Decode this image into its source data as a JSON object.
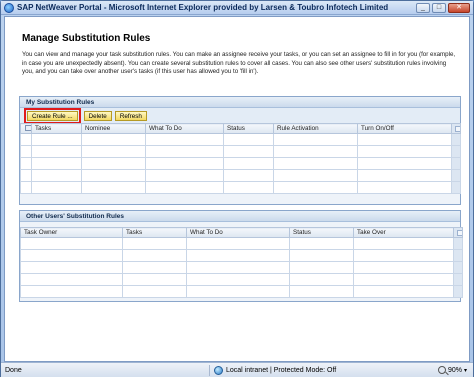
{
  "window": {
    "title": "SAP NetWeaver Portal - Microsoft Internet Explorer provided by Larsen & Toubro Infotech Limited",
    "minimize": "_",
    "maximize": "□",
    "close": "✕"
  },
  "page": {
    "title": "Manage Substitution Rules",
    "description": [
      "You can view and manage your task substitution rules. You can make an assignee receive your tasks, or you can set an assignee to fill in for you (for example,",
      "in case you are unexpectedly absent). You can create several substitution rules to cover all cases. You can also see other users' substitution rules involving",
      "you, and you can take over another user's tasks (if this user has allowed you to 'fill in')."
    ]
  },
  "my_rules": {
    "heading": "My Substitution Rules",
    "buttons": {
      "create": "Create Rule ...",
      "delete": "Delete",
      "refresh": "Refresh"
    },
    "columns": [
      "Tasks",
      "Nominee",
      "What To Do",
      "Status",
      "Rule Activation",
      "Turn On/Off"
    ],
    "row_count": 5
  },
  "other_rules": {
    "heading": "Other Users' Substitution Rules",
    "columns": [
      "Task Owner",
      "Tasks",
      "What To Do",
      "Status",
      "Take Over"
    ],
    "row_count": 5
  },
  "statusbar": {
    "left": "Done",
    "zone": "Local intranet | Protected Mode: Off",
    "zoom": "90%",
    "zoom_chevron": "▾"
  },
  "icons": {
    "browser": "ie-icon",
    "zone": "globe-icon",
    "zoom": "zoom-icon"
  },
  "colors": {
    "highlight": "#e01b1b",
    "button_bg": "#f3d963",
    "panel_header": "#cbdaec"
  }
}
